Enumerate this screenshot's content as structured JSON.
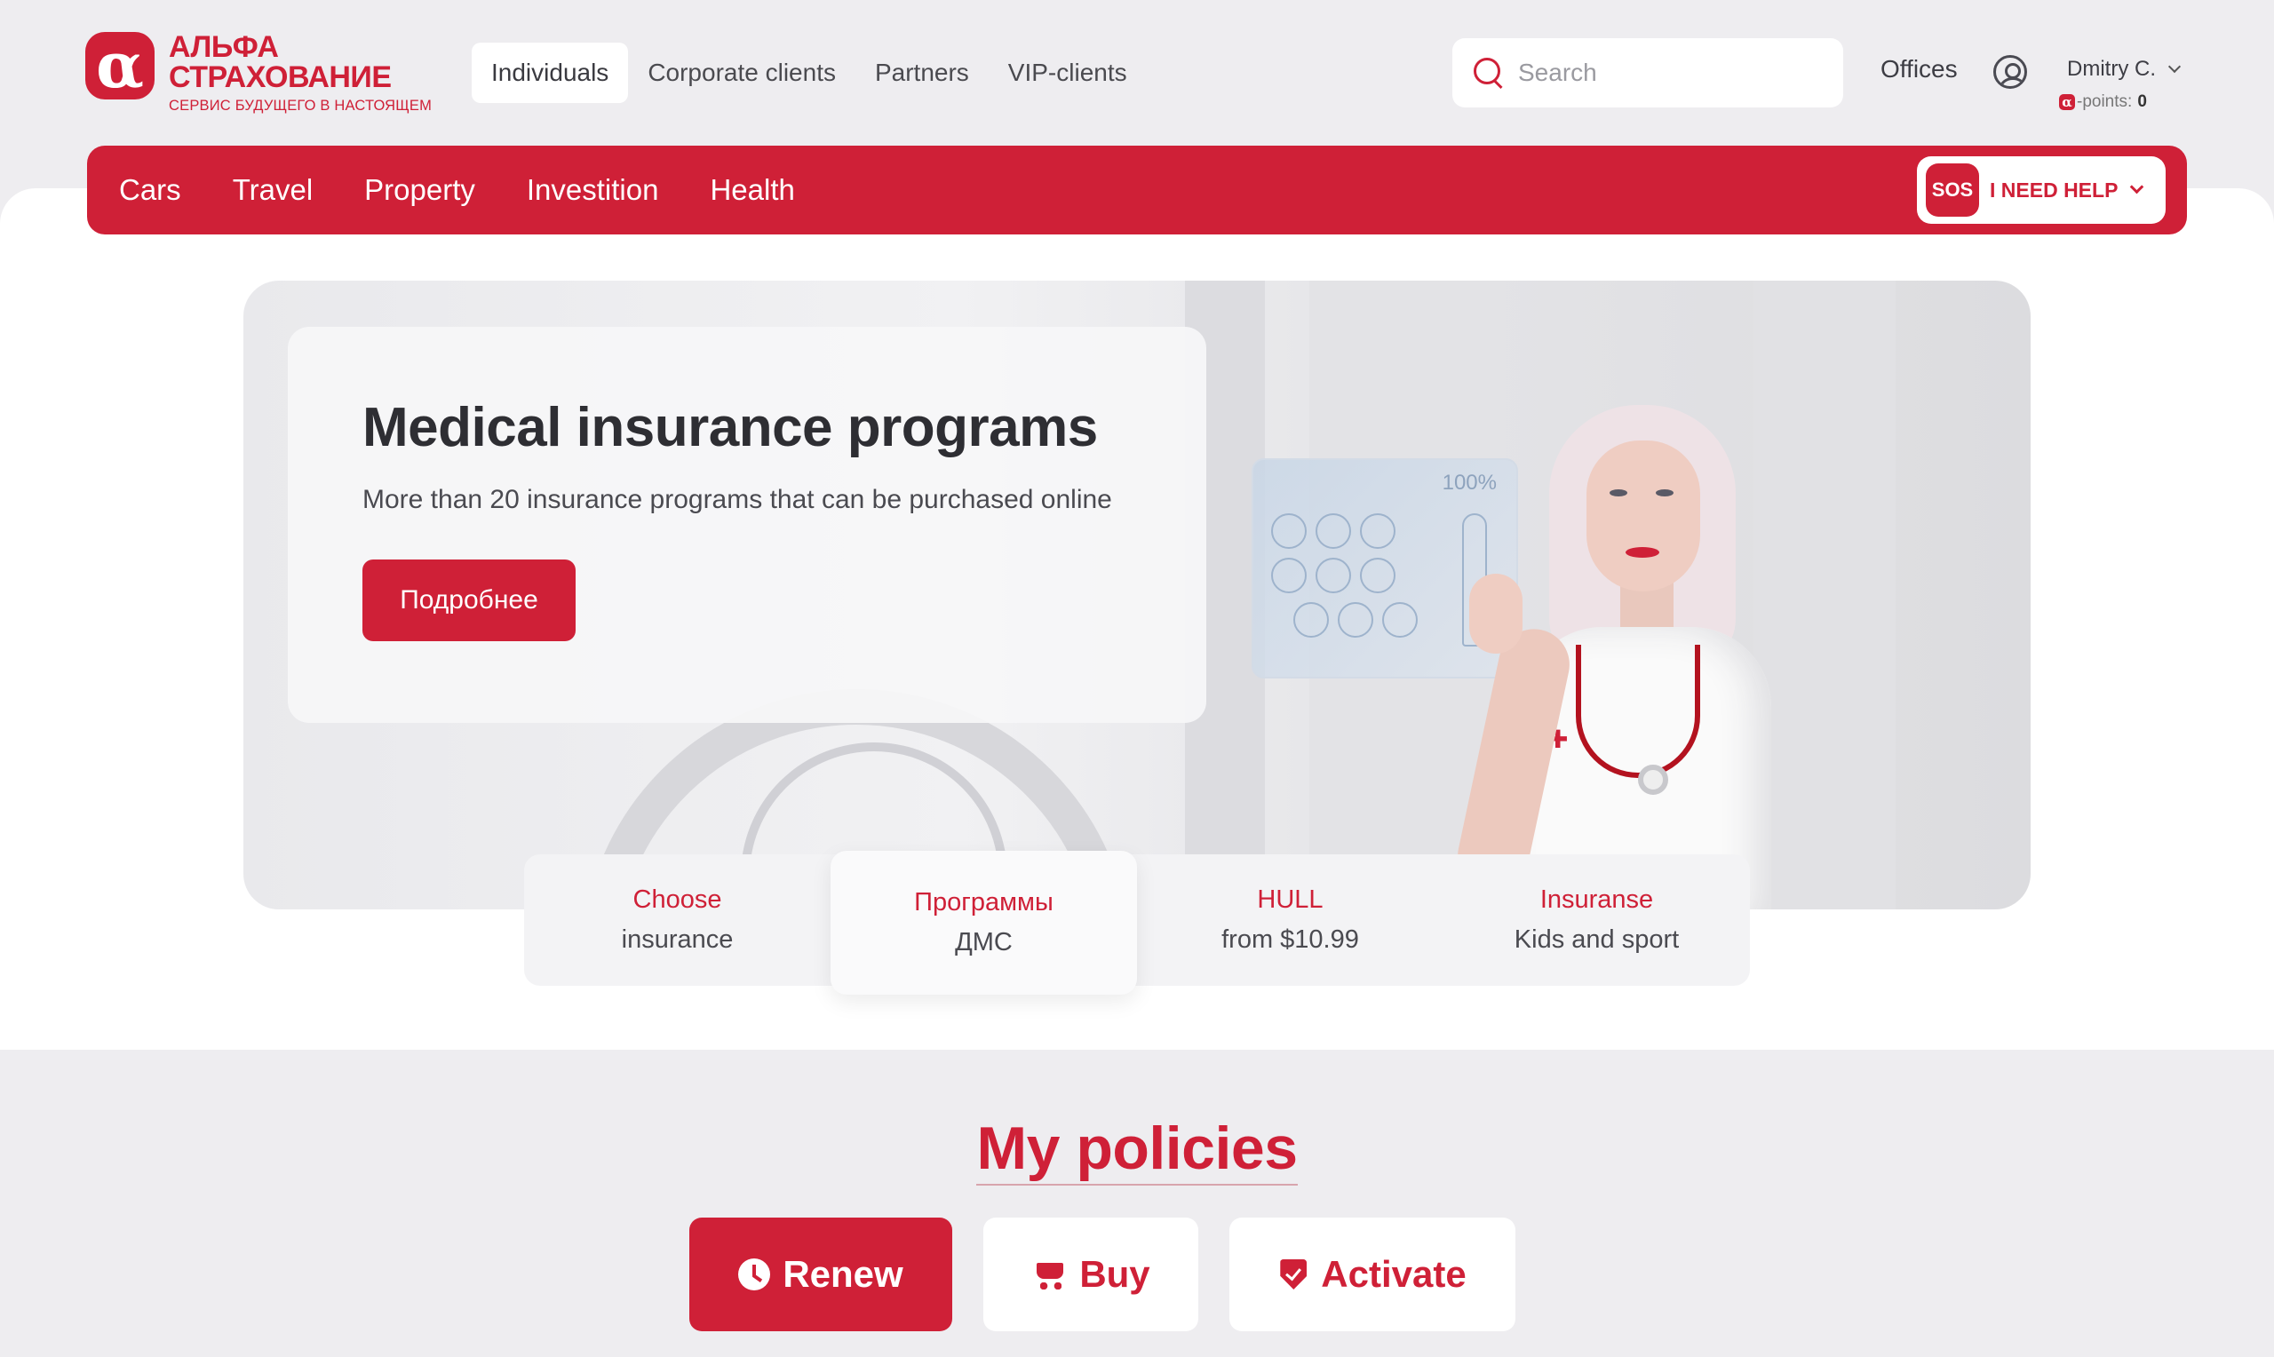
{
  "brand": {
    "logo_glyph": "α",
    "name_line1": "АЛЬФА",
    "name_line2": "СТРАХОВАНИЕ",
    "tagline": "СЕРВИС БУДУЩЕГО В НАСТОЯЩЕМ",
    "accent_color": "#cf2037"
  },
  "main_nav": {
    "items": [
      {
        "label": "Individuals",
        "active": true
      },
      {
        "label": "Corporate clients",
        "active": false
      },
      {
        "label": "Partners",
        "active": false
      },
      {
        "label": "VIP-clients",
        "active": false
      }
    ]
  },
  "search": {
    "placeholder": "Search",
    "value": "",
    "icon": "search-icon"
  },
  "header_links": {
    "offices": "Offices",
    "user_icon": "user-icon"
  },
  "user": {
    "name": "Dmitry C.",
    "points_glyph": "α",
    "points_label": "-points:",
    "points_value": "0"
  },
  "categories": {
    "items": [
      "Cars",
      "Travel",
      "Property",
      "Investition",
      "Health"
    ]
  },
  "sos": {
    "badge": "SOS",
    "label": "I NEED HELP"
  },
  "hero": {
    "title": "Medical insurance programs",
    "subtitle": "More than 20 insurance programs that can be purchased online",
    "button": "Подробнее",
    "holo_percent": "100%"
  },
  "quick_tabs": [
    {
      "line1": "Choose",
      "line2": "insurance",
      "active": false
    },
    {
      "line1": "Программы",
      "line2": "ДМС",
      "active": true
    },
    {
      "line1": "HULL",
      "line2": "from $10.99",
      "active": false
    },
    {
      "line1": "Insuranse",
      "line2": "Kids and sport",
      "active": false
    }
  ],
  "policies": {
    "title": "My policies",
    "buttons": [
      {
        "label": "Renew",
        "icon": "clock-icon",
        "primary": true
      },
      {
        "label": "Buy",
        "icon": "cart-icon",
        "primary": false
      },
      {
        "label": "Activate",
        "icon": "shield-icon",
        "primary": false
      }
    ]
  }
}
